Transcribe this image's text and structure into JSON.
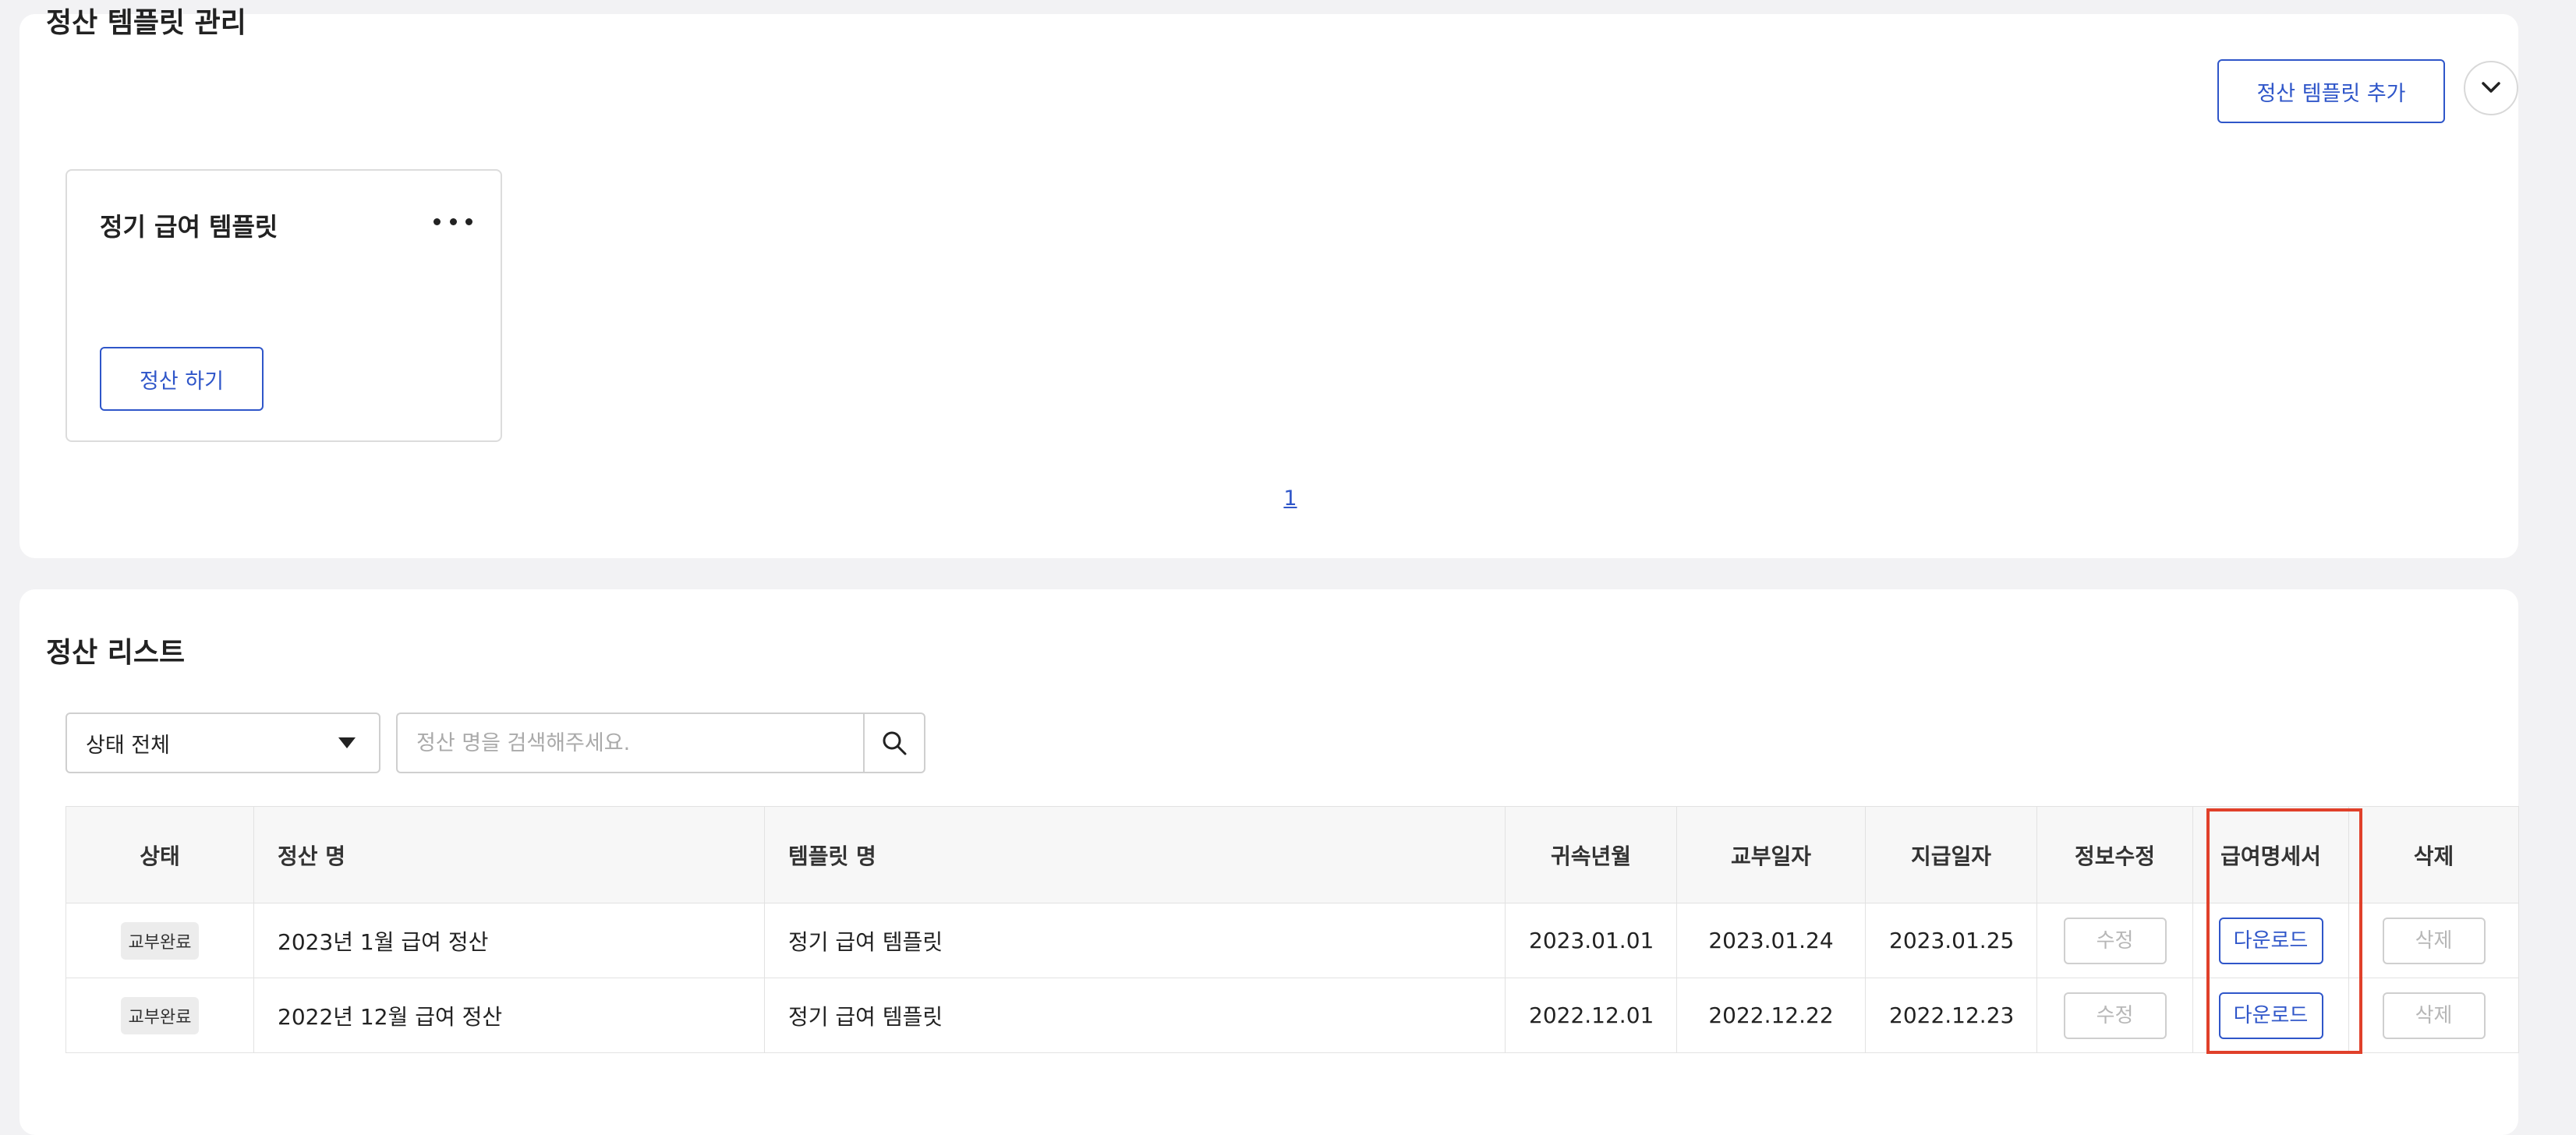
{
  "template_section": {
    "title": "정산 템플릿 관리",
    "add_button_label": "정산 템플릿 추가",
    "collapse_icon": "chevron-down-icon",
    "cards": [
      {
        "title": "정기 급여 템플릿",
        "action_label": "정산 하기",
        "more_icon": "more-horizontal-icon"
      }
    ],
    "pagination": {
      "current_page": "1"
    }
  },
  "list_section": {
    "title": "정산 리스트",
    "status_filter": {
      "selected": "상태 전체"
    },
    "search": {
      "placeholder": "정산 명을 검색해주세요.",
      "value": ""
    },
    "table": {
      "headers": [
        "상태",
        "정산 명",
        "템플릿 명",
        "귀속년월",
        "교부일자",
        "지급일자",
        "정보수정",
        "급여명세서",
        "삭제"
      ],
      "rows": [
        {
          "status": "교부완료",
          "name": "2023년 1월 급여 정산",
          "template": "정기 급여 템플릿",
          "attribution_month": "2023.01.01",
          "issue_date": "2023.01.24",
          "payment_date": "2023.01.25",
          "edit_label": "수정",
          "download_label": "다운로드",
          "delete_label": "삭제"
        },
        {
          "status": "교부완료",
          "name": "2022년 12월 급여 정산",
          "template": "정기 급여 템플릿",
          "attribution_month": "2022.12.01",
          "issue_date": "2022.12.22",
          "payment_date": "2022.12.23",
          "edit_label": "수정",
          "download_label": "다운로드",
          "delete_label": "삭제"
        }
      ]
    }
  },
  "colors": {
    "accent": "#2f56c9",
    "highlight": "#e0402a",
    "background": "#f2f2f4",
    "badge_bg": "#ececec"
  }
}
